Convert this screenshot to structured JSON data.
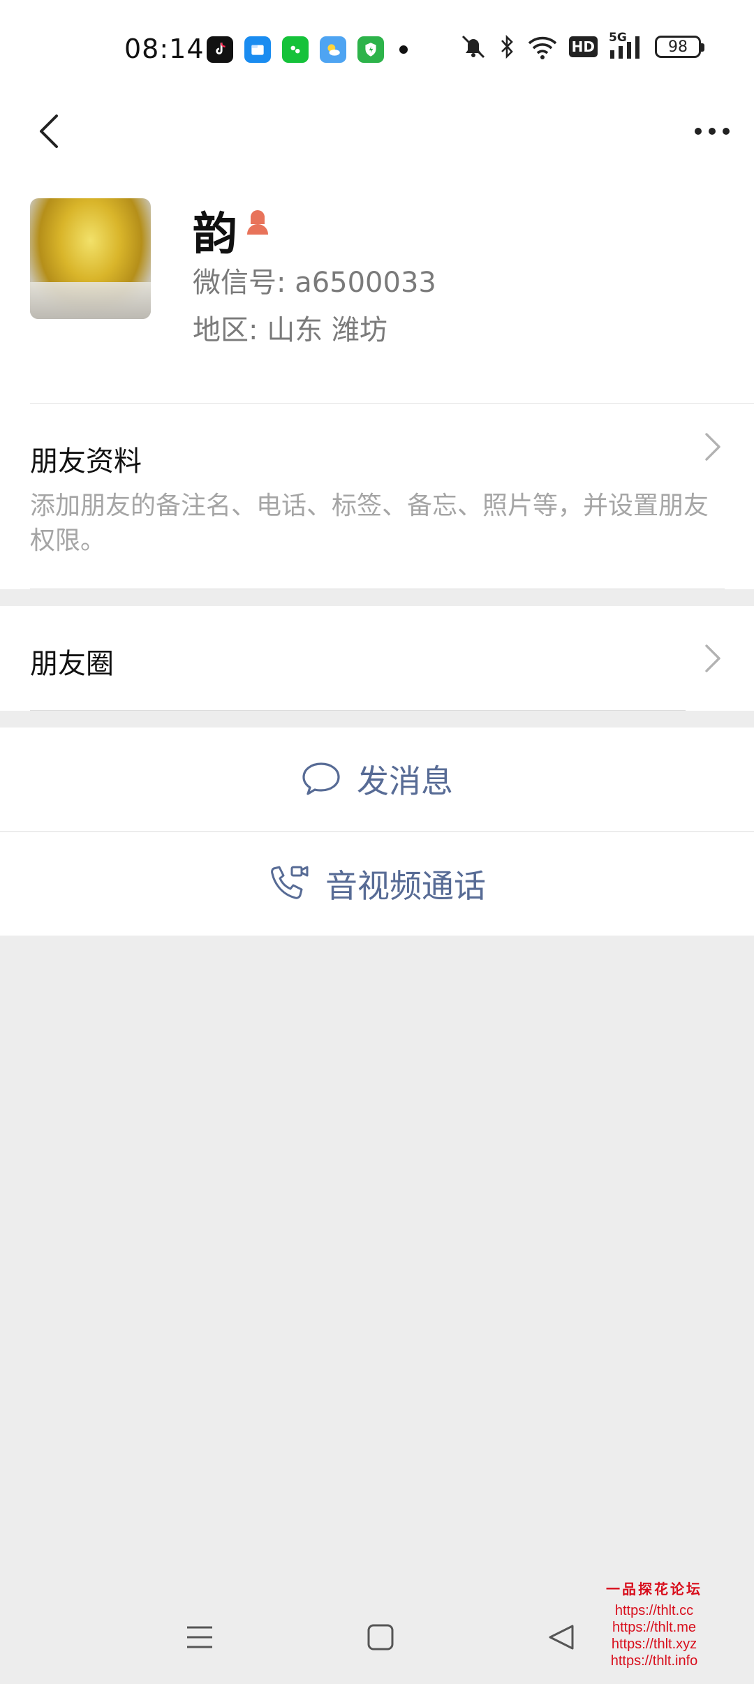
{
  "status_bar": {
    "time": "08:14",
    "app_icons": [
      "douyin-icon",
      "files-icon",
      "wechat-mini-icon",
      "weather-icon",
      "security-icon"
    ],
    "network": "5G",
    "hd_badge": "HD",
    "battery": "98"
  },
  "nav": {
    "back_icon": "chevron-left-icon",
    "more_icon": "more-dots-icon"
  },
  "profile": {
    "name": "韵",
    "gender_icon": "female-icon",
    "wechat_id": "微信号:  a6500033",
    "region": "地区:  山东  潍坊"
  },
  "friend_info": {
    "title": "朋友资料",
    "description": "添加朋友的备注名、电话、标签、备忘、照片等，并设置朋友权限。"
  },
  "moments": {
    "title": "朋友圈"
  },
  "actions": {
    "message_label": "发消息",
    "call_label": "音视频通话"
  },
  "watermark": {
    "title": "一品探花论坛",
    "links": [
      "https://thlt.cc",
      "https://thlt.me",
      "https://thlt.xyz",
      "https://thlt.info"
    ]
  },
  "colors": {
    "accent_link": "#576b95",
    "female_icon": "#e8735a",
    "background": "#ededed"
  }
}
